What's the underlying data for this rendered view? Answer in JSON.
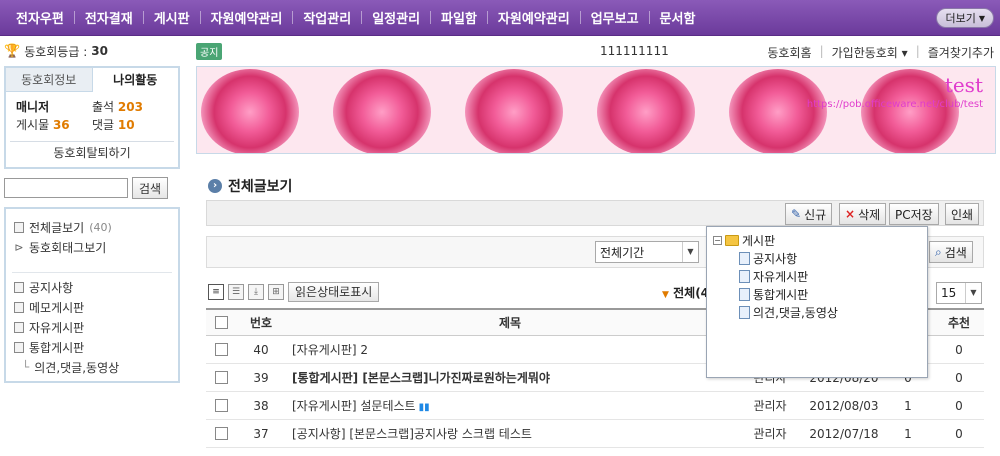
{
  "nav": {
    "items": [
      "전자우편",
      "전자결재",
      "게시판",
      "자원예약관리",
      "작업관리",
      "일정관리",
      "파일함",
      "자원예약관리",
      "업무보고",
      "문서함"
    ],
    "more": "더보기"
  },
  "sidebar": {
    "grade_label": "동호회등급 :",
    "grade_value": "30",
    "tabs": [
      "동호회정보",
      "나의활동"
    ],
    "manager_label": "매니저",
    "attendance_label": "출석",
    "attendance_value": "203",
    "posts_label": "게시물",
    "posts_value": "36",
    "comments_label": "댓글",
    "comments_value": "10",
    "leave_label": "동호회탈퇴하기",
    "search_button": "검색",
    "menu_all": "전체글보기",
    "menu_all_count": "(40)",
    "menu_tag": "동호회태그보기",
    "boards": [
      "공지사항",
      "메모게시판",
      "자유게시판",
      "통합게시판"
    ],
    "sub_board": "의견,댓글,동영상"
  },
  "infobar": {
    "notice_badge": "공지",
    "notice_text": "111111111",
    "links": [
      "동호회홈",
      "가입한동호회 ▾",
      "즐겨찾기추가"
    ]
  },
  "banner": {
    "title": "test",
    "url": "https://pob.officeware.net/club/test"
  },
  "content": {
    "section_title": "전체글보기",
    "buttons": {
      "new": "신규",
      "delete": "삭제",
      "pc_save": "PC저장",
      "print": "인쇄",
      "search": "검색"
    },
    "period_select": "전체기간",
    "read_status_button": "읽은상태로표시",
    "total_label": "전체(4",
    "page_size": "15"
  },
  "table": {
    "headers": {
      "no": "번호",
      "title": "제목",
      "recommend": "추천"
    },
    "rows": [
      {
        "no": "40",
        "title": "[자유게시판] 2",
        "writer": "",
        "date": "",
        "hits": "",
        "rec": "0"
      },
      {
        "no": "39",
        "title": "[통합게시판] [본문스크랩]니가진짜로원하는게뭐야",
        "writer": "관리자",
        "date": "2012/08/20",
        "hits": "0",
        "rec": "0"
      },
      {
        "no": "38",
        "title": "[자유게시판] 설문테스트",
        "writer": "관리자",
        "date": "2012/08/03",
        "hits": "1",
        "rec": "0"
      },
      {
        "no": "37",
        "title": "[공지사항] [본문스크랩]공지사랑 스크랩 테스트",
        "writer": "관리자",
        "date": "2012/07/18",
        "hits": "1",
        "rec": "0"
      }
    ]
  },
  "tree": {
    "root": "게시판",
    "children": [
      "공지사항",
      "자유게시판",
      "통합게시판",
      "의견,댓글,동영상"
    ]
  }
}
